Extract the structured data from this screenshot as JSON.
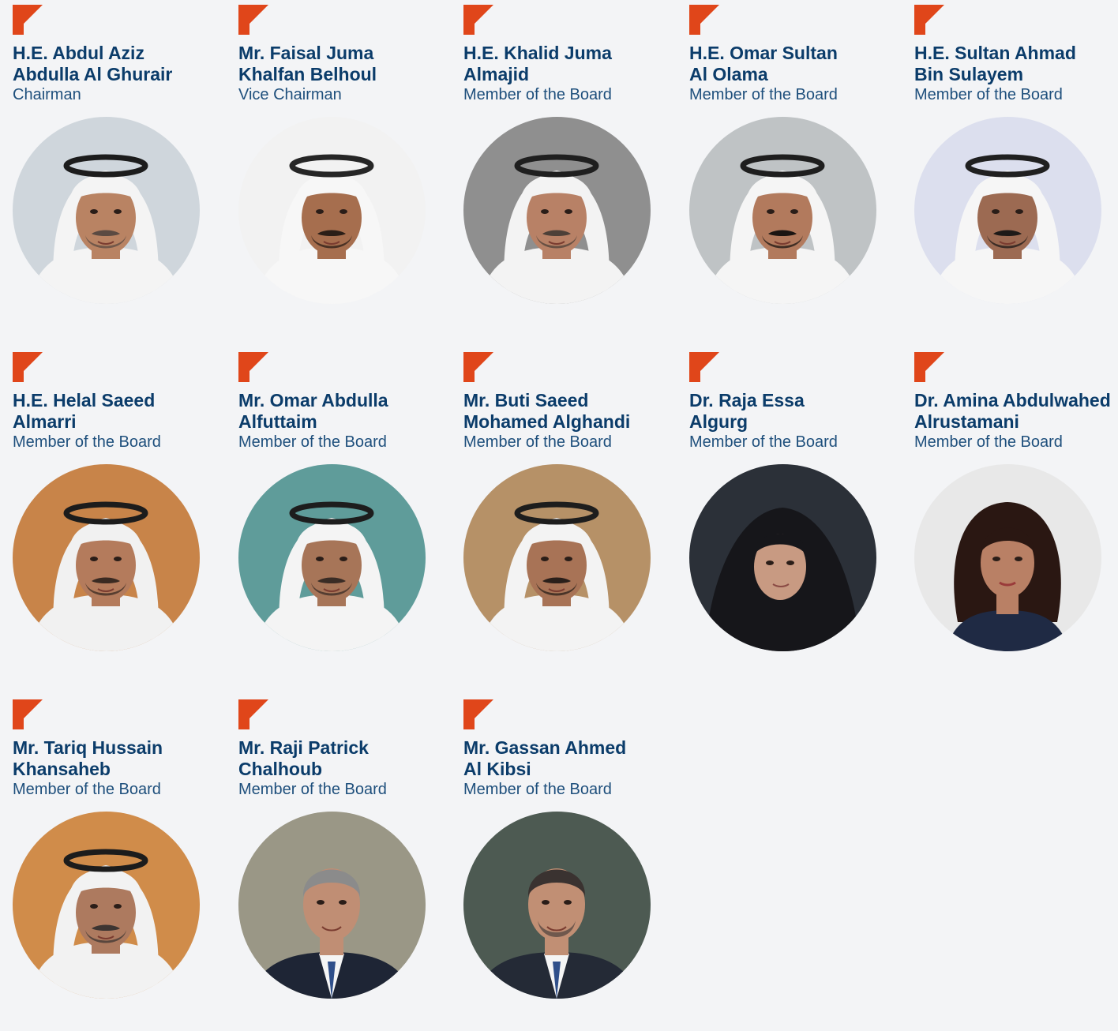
{
  "colors": {
    "background": "#f3f4f6",
    "accent": "#e0461a",
    "name": "#0b3c6a",
    "role": "#1e4f7c"
  },
  "board": [
    {
      "name_line1": "H.E. Abdul Aziz",
      "name_line2": "Abdulla Al Ghurair",
      "role": "Chairman",
      "photo": {
        "bg": "#cfd6dc",
        "skin": "#b98363",
        "attire": "headdress",
        "cloth": "#f4f4f4",
        "band": "#1c1c1c",
        "beard": "#5b4a42"
      }
    },
    {
      "name_line1": "Mr. Faisal Juma",
      "name_line2": "Khalfan Belhoul",
      "role": "Vice Chairman",
      "photo": {
        "bg": "#f2f2f2",
        "skin": "#a66e4e",
        "attire": "headdress",
        "cloth": "#f7f7f7",
        "band": "#262626",
        "beard": "#2b1e17"
      }
    },
    {
      "name_line1": "H.E. Khalid Juma",
      "name_line2": "Almajid",
      "role": "Member of the Board",
      "photo": {
        "bg": "#8f8f8f",
        "skin": "#b88166",
        "attire": "headdress",
        "cloth": "#f3f3f3",
        "band": "#1f1f1f",
        "beard": "#4d4038"
      }
    },
    {
      "name_line1": "H.E. Omar Sultan",
      "name_line2": "Al Olama",
      "role": "Member of the Board",
      "photo": {
        "bg": "#bfc3c5",
        "skin": "#b27a5d",
        "attire": "headdress",
        "cloth": "#f5f5f5",
        "band": "#1e1e1e",
        "beard": "#1b1512"
      }
    },
    {
      "name_line1": "H.E. Sultan Ahmad",
      "name_line2": "Bin Sulayem",
      "role": "Member of the Board",
      "photo": {
        "bg": "#dcdfee",
        "skin": "#9c6a52",
        "attire": "headdress",
        "cloth": "#f6f6f6",
        "band": "#202020",
        "beard": "#1e1a18"
      }
    },
    {
      "name_line1": "H.E. Helal Saeed",
      "name_line2": "Almarri",
      "role": "Member of the Board",
      "photo": {
        "bg": "#c88449",
        "skin": "#b47b5c",
        "attire": "headdress",
        "cloth": "#f1f1f1",
        "band": "#1c1c1c",
        "beard": "#3a2a22"
      }
    },
    {
      "name_line1": "Mr. Omar Abdulla",
      "name_line2": "Alfuttaim",
      "role": "Member of the Board",
      "photo": {
        "bg": "#5f9c9a",
        "skin": "#a77558",
        "attire": "headdress",
        "cloth": "#f4f4f4",
        "band": "#1d1d1d",
        "beard": "#3a2c25"
      }
    },
    {
      "name_line1": "Mr. Buti Saeed",
      "name_line2": "Mohamed Alghandi",
      "role": "Member of the Board",
      "photo": {
        "bg": "#b69167",
        "skin": "#a87356",
        "attire": "headdress",
        "cloth": "#f3f3f3",
        "band": "#1d1d1d",
        "beard": "#2a1f1a"
      }
    },
    {
      "name_line1": "Dr. Raja Essa",
      "name_line2": "Algurg",
      "role": "Member of the Board",
      "photo": {
        "bg": "#2b3038",
        "skin": "#c89a82",
        "attire": "hijab",
        "cloth": "#16161a",
        "band": "#16161a",
        "beard": "none"
      }
    },
    {
      "name_line1": "Dr. Amina Abdulwahed",
      "name_line2": "Alrustamani",
      "role": "Member of the Board",
      "photo": {
        "bg": "#e8e8e8",
        "skin": "#b98065",
        "attire": "hair",
        "cloth": "#1f2a44",
        "band": "#2a1712",
        "beard": "none"
      }
    },
    {
      "name_line1": "Mr. Tariq Hussain",
      "name_line2": "Khansaheb",
      "role": "Member of the Board",
      "photo": {
        "bg": "#d08c4a",
        "skin": "#ad7a5f",
        "attire": "headdress",
        "cloth": "#f2f2f2",
        "band": "#1c1c1c",
        "beard": "#3d3532"
      }
    },
    {
      "name_line1": "Mr. Raji Patrick",
      "name_line2": "Chalhoub",
      "role": "Member of the Board",
      "photo": {
        "bg": "#9a9786",
        "skin": "#c08e74",
        "attire": "suit",
        "cloth": "#1e2535",
        "band": "#8b8b8b",
        "beard": "none"
      }
    },
    {
      "name_line1": "Mr. Gassan Ahmed",
      "name_line2": "Al Kibsi",
      "role": "Member of the Board",
      "photo": {
        "bg": "#4d5a52",
        "skin": "#c18f74",
        "attire": "suit",
        "cloth": "#242a36",
        "band": "#3a3230",
        "beard": "#5a4a44"
      }
    }
  ]
}
